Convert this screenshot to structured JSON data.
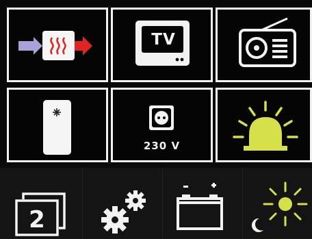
{
  "tiles": [
    {
      "name": "heater",
      "icon": "heater-icon"
    },
    {
      "name": "tv",
      "icon": "tv-icon",
      "label": "TV"
    },
    {
      "name": "radio",
      "icon": "radio-icon"
    },
    {
      "name": "fridge",
      "icon": "fridge-icon"
    },
    {
      "name": "socket",
      "icon": "power-socket-icon",
      "label": "230 V"
    },
    {
      "name": "light",
      "icon": "warning-light-icon"
    }
  ],
  "bottom_bar": {
    "page_indicator": "2",
    "settings_icon": "gears-icon",
    "battery_icon": "battery-icon",
    "day_night_icon": "sun-moon-icon"
  },
  "colors": {
    "tile_border": "#f2f2f2",
    "background": "#050505",
    "heater_in": "#a9a2d6",
    "heater_out": "#e02424",
    "heater_waves": "#e02424",
    "light_yellow": "#d6e04a"
  }
}
